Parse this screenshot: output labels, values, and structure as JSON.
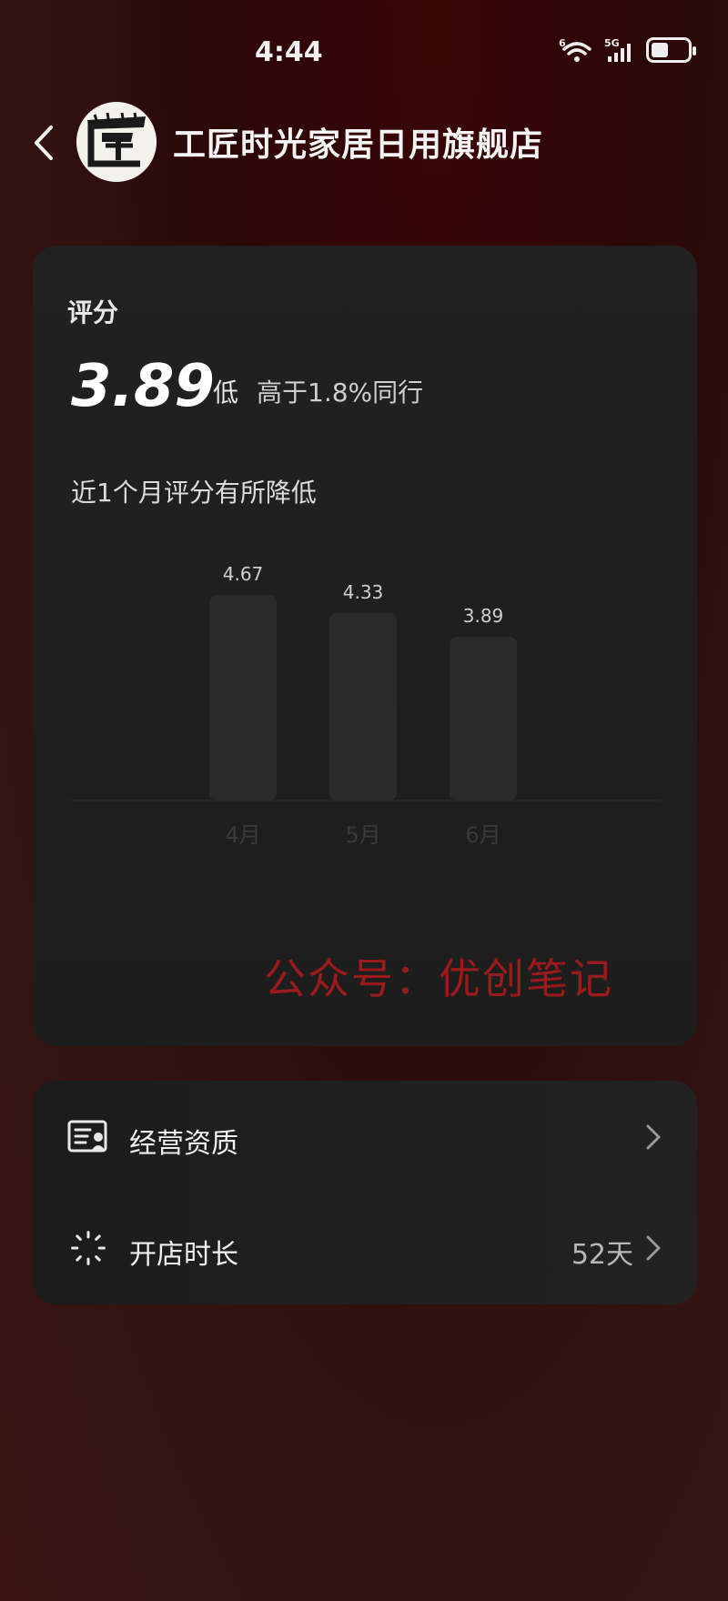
{
  "status_bar": {
    "time": "4:44",
    "network": "5G",
    "wifi_badge": "6"
  },
  "header": {
    "store_name": "工匠时光家居日用旗舰店",
    "logo_char": "匠"
  },
  "score_card": {
    "label": "评分",
    "score": "3.89",
    "level": "低",
    "compare": "高于1.8%同行",
    "trend": "近1个月评分有所降低",
    "watermark": "公众号：优创笔记"
  },
  "chart_data": {
    "type": "bar",
    "categories": [
      "4月",
      "5月",
      "6月"
    ],
    "values": [
      4.67,
      4.33,
      3.89
    ],
    "value_labels": [
      "4.67",
      "4.33",
      "3.89"
    ],
    "ylim": [
      0,
      5
    ],
    "grid": false
  },
  "info_card": {
    "rows": [
      {
        "label": "经营资质",
        "value": ""
      },
      {
        "label": "开店时长",
        "value": "52天"
      }
    ]
  },
  "colors": {
    "bar": "#2a2a2a",
    "watermark": "#9b1a1c",
    "card": "#1f1f1f"
  }
}
